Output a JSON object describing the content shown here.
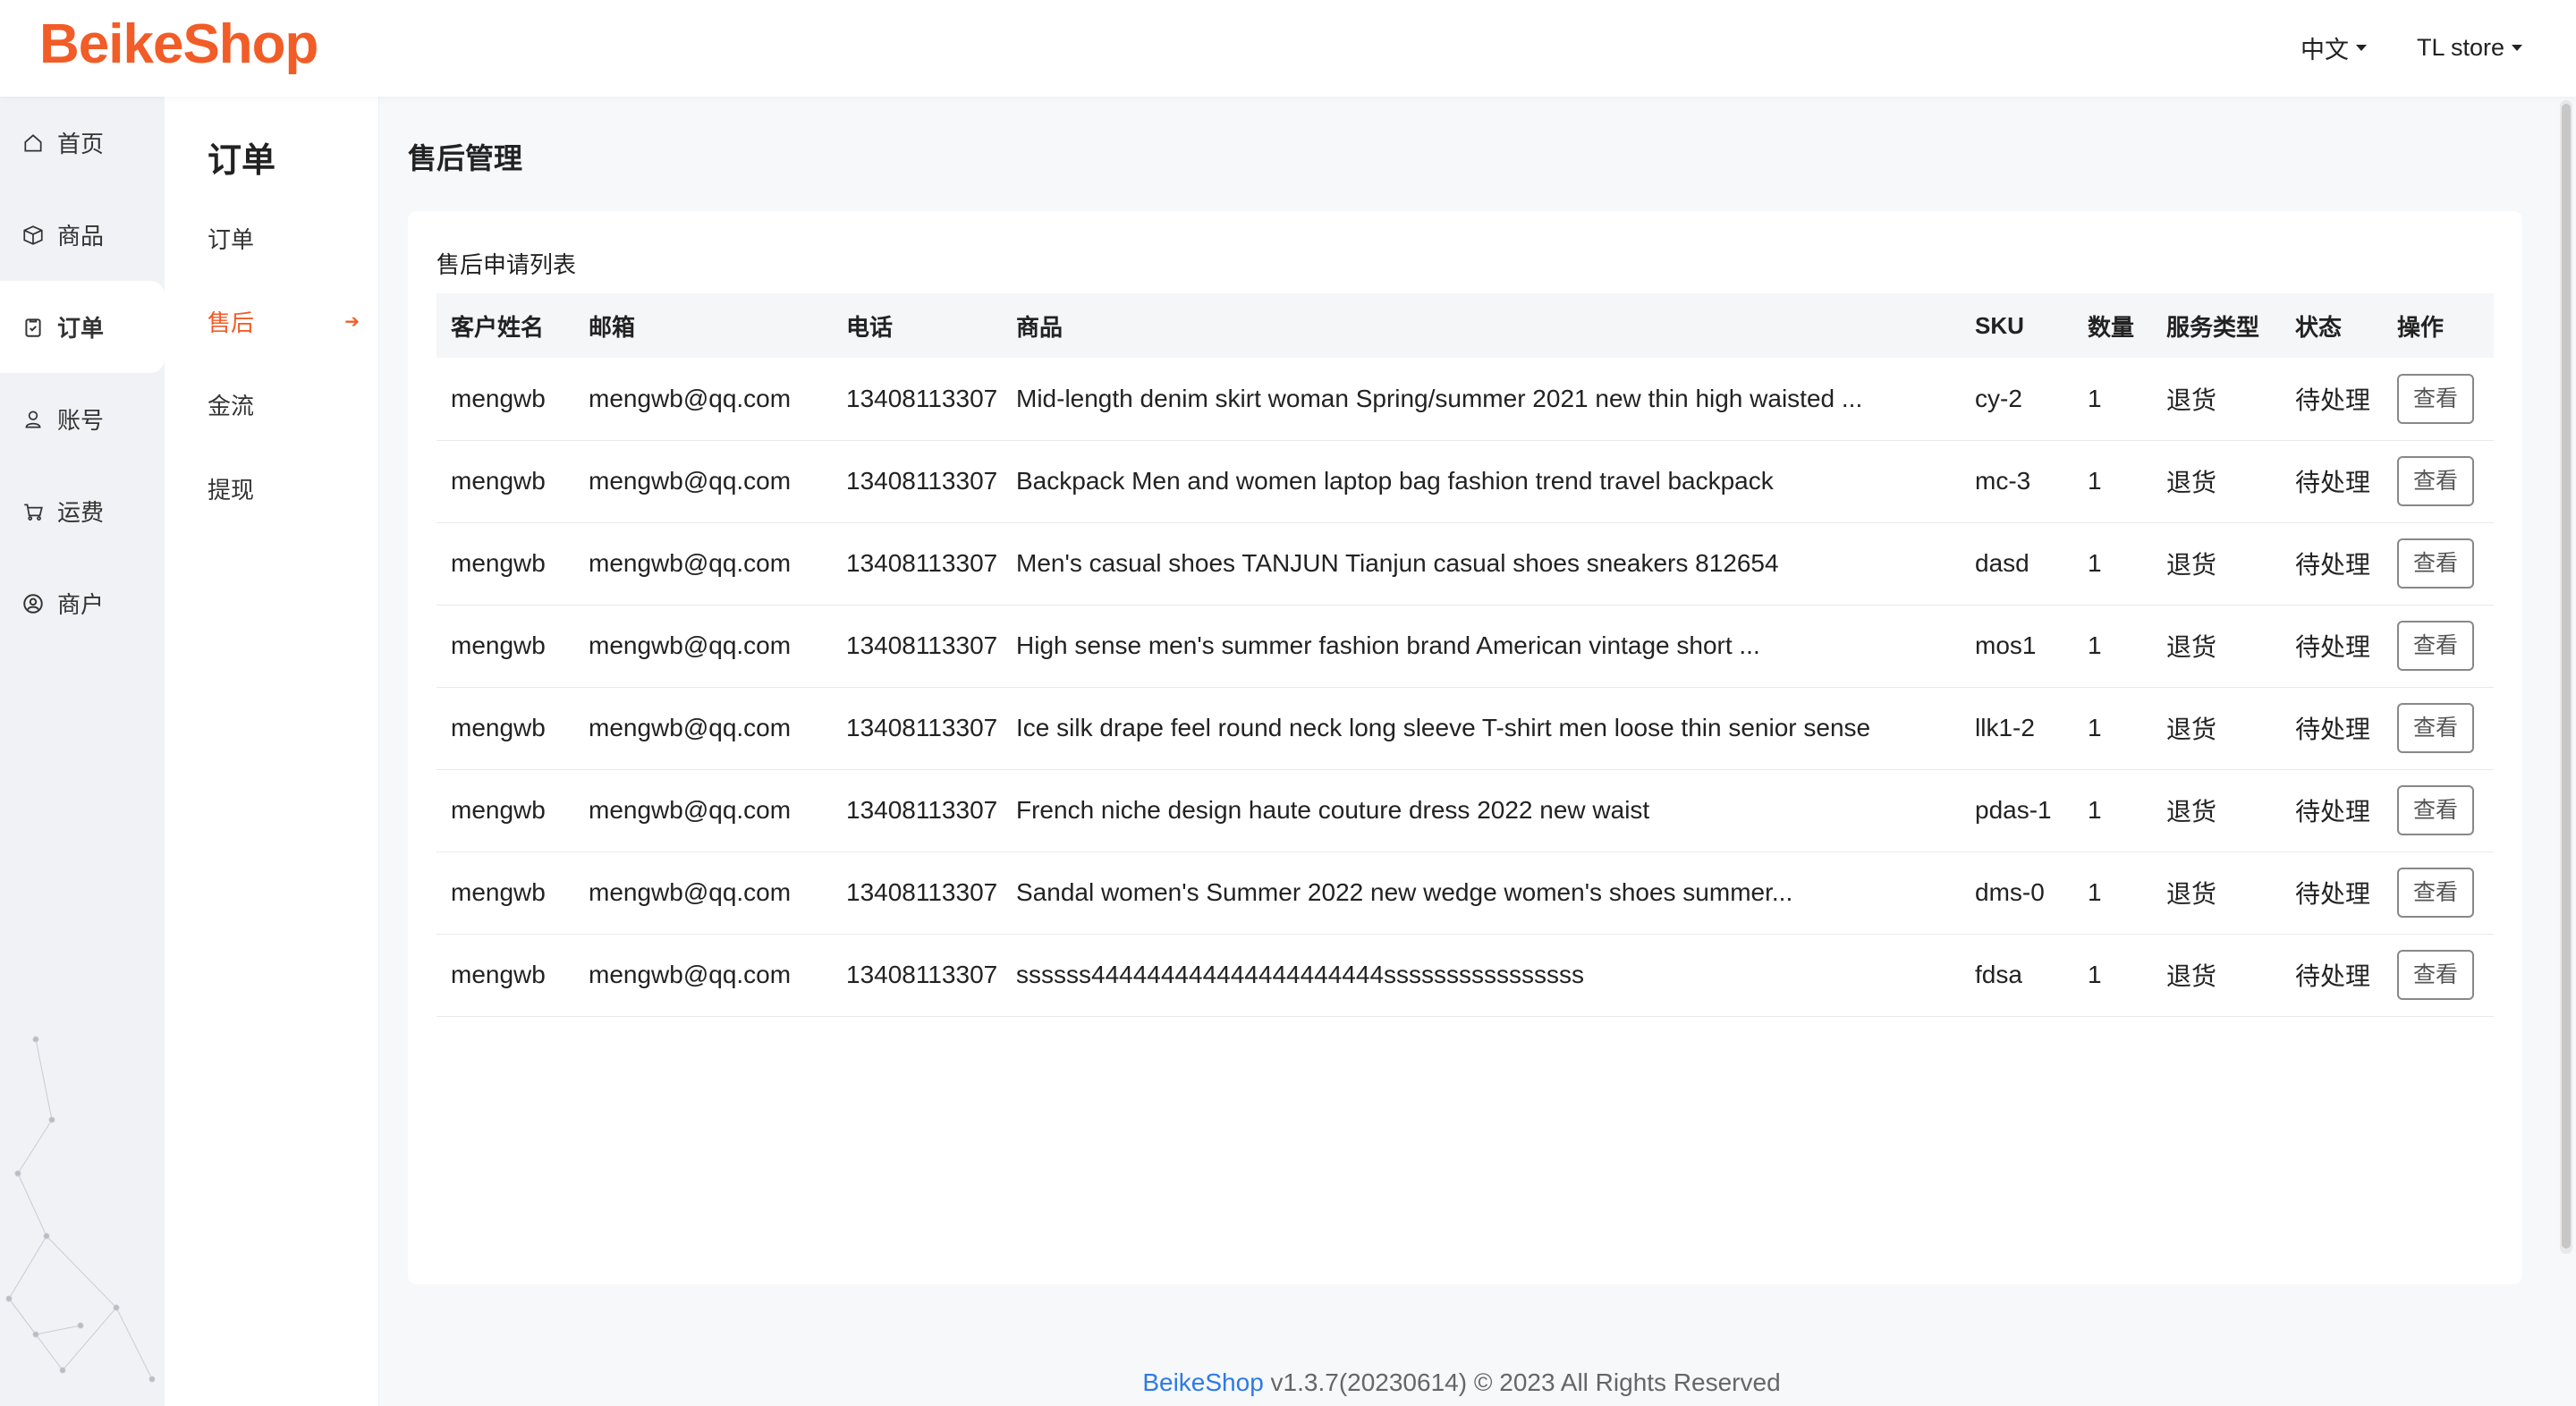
{
  "app": {
    "logo": "BeikeShop",
    "brand_color": "#f25c27"
  },
  "header": {
    "language": "中文",
    "store": "TL store"
  },
  "sidebar": {
    "items": [
      {
        "label": "首页",
        "icon": "home-icon",
        "active": false
      },
      {
        "label": "商品",
        "icon": "box-icon",
        "active": false
      },
      {
        "label": "订单",
        "icon": "clipboard-icon",
        "active": true
      },
      {
        "label": "账号",
        "icon": "user-icon",
        "active": false
      },
      {
        "label": "运费",
        "icon": "cart-icon",
        "active": false
      },
      {
        "label": "商户",
        "icon": "person-circle-icon",
        "active": false
      }
    ]
  },
  "subnav": {
    "title": "订单",
    "items": [
      {
        "label": "订单",
        "active": false
      },
      {
        "label": "售后",
        "active": true
      },
      {
        "label": "金流",
        "active": false
      },
      {
        "label": "提现",
        "active": false
      }
    ]
  },
  "main": {
    "page_title": "售后管理",
    "card_title": "售后申请列表",
    "columns": [
      "客户姓名",
      "邮箱",
      "电话",
      "商品",
      "SKU",
      "数量",
      "服务类型",
      "状态",
      "操作"
    ],
    "rows": [
      {
        "name": "mengwb",
        "email": "mengwb@qq.com",
        "phone": "13408113307",
        "product": "Mid-length denim skirt woman Spring/summer 2021 new thin high waisted ...",
        "sku": "cy-2",
        "qty": "1",
        "service": "退货",
        "status": "待处理",
        "action": "查看"
      },
      {
        "name": "mengwb",
        "email": "mengwb@qq.com",
        "phone": "13408113307",
        "product": "Backpack Men and women laptop bag fashion trend travel backpack",
        "sku": "mc-3",
        "qty": "1",
        "service": "退货",
        "status": "待处理",
        "action": "查看"
      },
      {
        "name": "mengwb",
        "email": "mengwb@qq.com",
        "phone": "13408113307",
        "product": "Men's casual shoes TANJUN Tianjun casual shoes sneakers 812654",
        "sku": "dasd",
        "qty": "1",
        "service": "退货",
        "status": "待处理",
        "action": "查看"
      },
      {
        "name": "mengwb",
        "email": "mengwb@qq.com",
        "phone": "13408113307",
        "product": "High sense men's summer fashion brand American vintage short ...",
        "sku": "mos1",
        "qty": "1",
        "service": "退货",
        "status": "待处理",
        "action": "查看"
      },
      {
        "name": "mengwb",
        "email": "mengwb@qq.com",
        "phone": "13408113307",
        "product": "Ice silk drape feel round neck long sleeve T-shirt men loose thin senior sense",
        "sku": "llk1-2",
        "qty": "1",
        "service": "退货",
        "status": "待处理",
        "action": "查看"
      },
      {
        "name": "mengwb",
        "email": "mengwb@qq.com",
        "phone": "13408113307",
        "product": "French niche design haute couture dress 2022 new waist",
        "sku": "pdas-1",
        "qty": "1",
        "service": "退货",
        "status": "待处理",
        "action": "查看"
      },
      {
        "name": "mengwb",
        "email": "mengwb@qq.com",
        "phone": "13408113307",
        "product": "Sandal women's Summer 2022 new wedge women's shoes summer...",
        "sku": "dms-0",
        "qty": "1",
        "service": "退货",
        "status": "待处理",
        "action": "查看"
      },
      {
        "name": "mengwb",
        "email": "mengwb@qq.com",
        "phone": "13408113307",
        "product": "ssssss444444444444444444444ssssssssssssssss",
        "sku": "fdsa",
        "qty": "1",
        "service": "退货",
        "status": "待处理",
        "action": "查看"
      }
    ]
  },
  "footer": {
    "brand": "BeikeShop",
    "version": "v1.3.7(20230614)",
    "copyright": "© 2023 All Rights Reserved"
  }
}
